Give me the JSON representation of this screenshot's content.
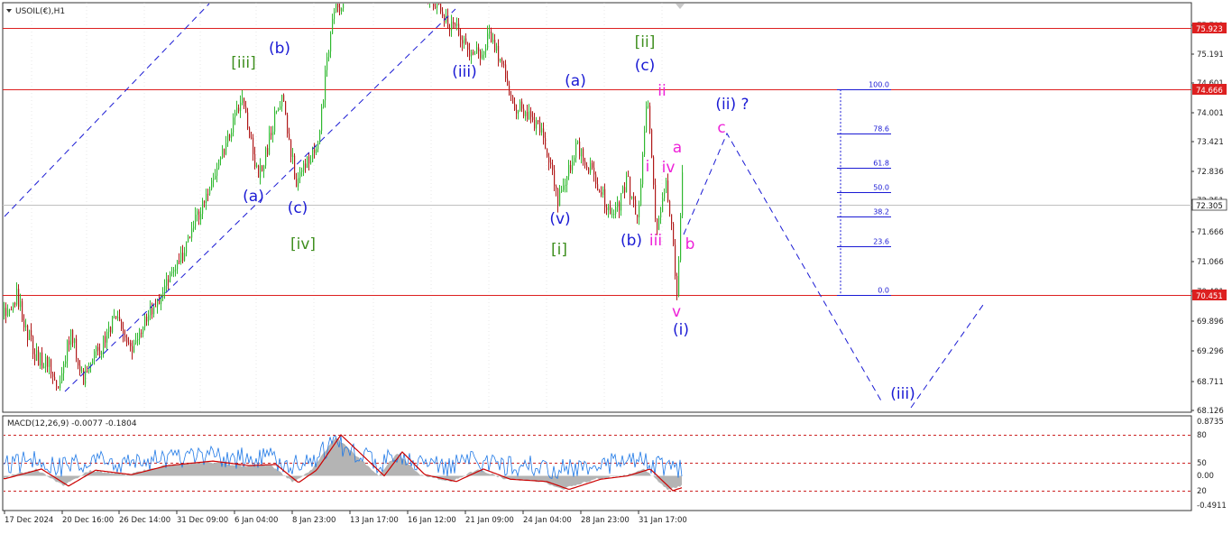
{
  "symbol_label": "USOIL(€),H1",
  "indicator_label": "MACD(12,26,9) -0.0077 -0.1804",
  "colors": {
    "bull": "#2fb82f",
    "bear": "#b01818",
    "hline": "#dd2020",
    "price_label_bg": "#dd2020",
    "blue_label": "#1a1ad4",
    "green_label": "#3f8f1f",
    "magenta_label": "#ee22d8",
    "fib": "#1a1ad4",
    "macd_hist": "#b4b4b4",
    "macd_main": "#1e78e6",
    "macd_signal": "#cc0000",
    "grid": "#d0d0d0"
  },
  "chart_data": [
    {
      "type": "candlestick",
      "name": "USOIL H1 price",
      "ylim": [
        68.126,
        76.2
      ],
      "y_ticks": [
        "75.791",
        "75.191",
        "74.601",
        "74.001",
        "73.421",
        "72.836",
        "72.251",
        "71.666",
        "71.066",
        "70.481",
        "69.896",
        "69.296",
        "68.711",
        "68.126"
      ],
      "x_ticks": [
        "17 Dec 2024",
        "20 Dec 16:00",
        "26 Dec 14:00",
        "31 Dec 09:00",
        "6 Jan 04:00",
        "8 Jan 23:00",
        "13 Jan 17:00",
        "16 Jan 12:00",
        "21 Jan 09:00",
        "24 Jan 04:00",
        "28 Jan 23:00",
        "31 Jan 17:00"
      ],
      "horizontal_levels": [
        {
          "value": 75.923,
          "label": "75.923"
        },
        {
          "value": 74.666,
          "label": "74.666"
        },
        {
          "value": 70.451,
          "label": "70.451"
        }
      ],
      "current_price": {
        "value": 72.305,
        "label": "72.305"
      },
      "price_path": [
        {
          "x": 0,
          "y": 69.9
        },
        {
          "x": 18,
          "y": 70.4
        },
        {
          "x": 38,
          "y": 69.2
        },
        {
          "x": 58,
          "y": 68.9
        },
        {
          "x": 64,
          "y": 68.55
        },
        {
          "x": 78,
          "y": 69.7
        },
        {
          "x": 92,
          "y": 68.75
        },
        {
          "x": 112,
          "y": 69.4
        },
        {
          "x": 130,
          "y": 70.1
        },
        {
          "x": 145,
          "y": 69.3
        },
        {
          "x": 170,
          "y": 70.2
        },
        {
          "x": 205,
          "y": 71.4
        },
        {
          "x": 240,
          "y": 73.1
        },
        {
          "x": 268,
          "y": 74.4
        },
        {
          "x": 286,
          "y": 72.8
        },
        {
          "x": 312,
          "y": 74.6
        },
        {
          "x": 328,
          "y": 72.7
        },
        {
          "x": 352,
          "y": 73.6
        },
        {
          "x": 368,
          "y": 76.2
        },
        {
          "x": 388,
          "y": 76.8
        },
        {
          "x": 450,
          "y": 77.0
        },
        {
          "x": 505,
          "y": 75.9
        },
        {
          "x": 525,
          "y": 75.3
        },
        {
          "x": 545,
          "y": 75.8
        },
        {
          "x": 568,
          "y": 74.4
        },
        {
          "x": 600,
          "y": 73.8
        },
        {
          "x": 618,
          "y": 72.4
        },
        {
          "x": 640,
          "y": 73.5
        },
        {
          "x": 662,
          "y": 72.7
        },
        {
          "x": 680,
          "y": 72.0
        },
        {
          "x": 695,
          "y": 72.8
        },
        {
          "x": 707,
          "y": 71.9
        },
        {
          "x": 717,
          "y": 74.6
        },
        {
          "x": 727,
          "y": 71.8
        },
        {
          "x": 737,
          "y": 72.8
        },
        {
          "x": 744,
          "y": 71.9
        },
        {
          "x": 750,
          "y": 70.45
        },
        {
          "x": 756,
          "y": 72.8
        }
      ],
      "wave_labels": [
        {
          "text": "[iii]",
          "tone": "green",
          "at": [
            270,
            69
          ]
        },
        {
          "text": "(b)",
          "tone": "blue",
          "at": [
            310,
            53
          ]
        },
        {
          "text": "(a)",
          "tone": "blue",
          "at": [
            281,
            217
          ]
        },
        {
          "text": "(c)",
          "tone": "blue",
          "at": [
            330,
            230
          ]
        },
        {
          "text": "[iv]",
          "tone": "green",
          "at": [
            336,
            270
          ]
        },
        {
          "text": "(iii)",
          "tone": "blue",
          "at": [
            515,
            79
          ]
        },
        {
          "text": "(a)",
          "tone": "blue",
          "at": [
            638,
            89
          ]
        },
        {
          "text": "(v)",
          "tone": "blue",
          "at": [
            621,
            242
          ]
        },
        {
          "text": "[i]",
          "tone": "green",
          "at": [
            620,
            276
          ]
        },
        {
          "text": "(b)",
          "tone": "blue",
          "at": [
            700,
            266
          ]
        },
        {
          "text": "[ii]",
          "tone": "green",
          "at": [
            715,
            46
          ]
        },
        {
          "text": "(c)",
          "tone": "blue",
          "at": [
            715,
            72
          ]
        },
        {
          "text": "ii",
          "tone": "magenta",
          "at": [
            734,
            100
          ]
        },
        {
          "text": "a",
          "tone": "magenta",
          "at": [
            751,
            163
          ]
        },
        {
          "text": "i",
          "tone": "magenta",
          "at": [
            718,
            184
          ]
        },
        {
          "text": "iv",
          "tone": "magenta",
          "at": [
            741,
            185
          ]
        },
        {
          "text": "iii",
          "tone": "magenta",
          "at": [
            727,
            266
          ]
        },
        {
          "text": "b",
          "tone": "magenta",
          "at": [
            765,
            270
          ]
        },
        {
          "text": "v",
          "tone": "magenta",
          "at": [
            750,
            345
          ]
        },
        {
          "text": "(i)",
          "tone": "blue",
          "at": [
            755,
            365
          ]
        },
        {
          "text": "(ii) ?",
          "tone": "blue",
          "at": [
            812,
            115
          ]
        },
        {
          "text": "c",
          "tone": "magenta",
          "at": [
            800,
            141
          ]
        },
        {
          "text": "(iii)",
          "tone": "blue",
          "at": [
            1001,
            436
          ]
        }
      ],
      "fibonacci": {
        "levels": [
          {
            "label": "100.0",
            "value": 74.666
          },
          {
            "label": "78.6",
            "value": 73.76
          },
          {
            "label": "61.8",
            "value": 73.05
          },
          {
            "label": "50.0",
            "value": 72.56
          },
          {
            "label": "38.2",
            "value": 72.06
          },
          {
            "label": "23.6",
            "value": 71.44
          },
          {
            "label": "0.0",
            "value": 70.451
          }
        ]
      }
    },
    {
      "type": "area",
      "name": "MACD(12,26,9)",
      "ylim": [
        -0.4911,
        0.8735
      ],
      "y_ticks": [
        "0.8735",
        "80",
        "50",
        "0.00",
        "20",
        "-0.4911"
      ],
      "indicator_levels": [
        80,
        50,
        20
      ],
      "main": -0.0077,
      "signal": -0.1804,
      "histogram_path": [
        {
          "x": 0,
          "y": -0.05
        },
        {
          "x": 40,
          "y": 0.12
        },
        {
          "x": 70,
          "y": -0.18
        },
        {
          "x": 100,
          "y": 0.1
        },
        {
          "x": 140,
          "y": 0.02
        },
        {
          "x": 180,
          "y": 0.18
        },
        {
          "x": 230,
          "y": 0.26
        },
        {
          "x": 270,
          "y": 0.18
        },
        {
          "x": 300,
          "y": 0.2
        },
        {
          "x": 325,
          "y": -0.12
        },
        {
          "x": 345,
          "y": 0.1
        },
        {
          "x": 372,
          "y": 0.72
        },
        {
          "x": 400,
          "y": 0.3
        },
        {
          "x": 420,
          "y": 0.0
        },
        {
          "x": 440,
          "y": 0.42
        },
        {
          "x": 465,
          "y": 0.02
        },
        {
          "x": 500,
          "y": -0.1
        },
        {
          "x": 530,
          "y": 0.12
        },
        {
          "x": 560,
          "y": -0.06
        },
        {
          "x": 600,
          "y": -0.1
        },
        {
          "x": 625,
          "y": -0.24
        },
        {
          "x": 660,
          "y": -0.06
        },
        {
          "x": 690,
          "y": 0.0
        },
        {
          "x": 715,
          "y": 0.12
        },
        {
          "x": 740,
          "y": -0.26
        },
        {
          "x": 756,
          "y": -0.18
        }
      ]
    }
  ]
}
